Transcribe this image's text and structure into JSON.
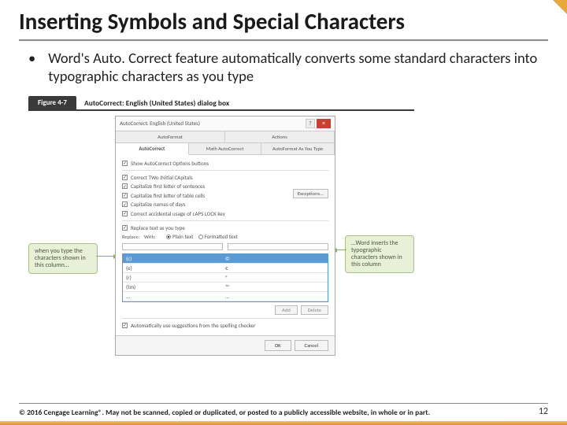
{
  "title": "Inserting Symbols and Special Characters",
  "bullet": "Word's Auto. Correct feature automatically converts some standard characters into typographic characters as you type",
  "figure": {
    "tab": "Figure 4-7",
    "caption": "AutoCorrect: English (United States) dialog box"
  },
  "dialog": {
    "title": "AutoCorrect: English (United States)",
    "tabs": [
      "AutoFormat",
      "Actions",
      "AutoCorrect",
      "Math AutoCorrect",
      "AutoFormat As You Type"
    ],
    "active_tab": 2,
    "opt_show": "Show AutoCorrect Options buttons",
    "checks": [
      "Correct TWo INitial CApitals",
      "Capitalize first letter of sentences",
      "Capitalize first letter of table cells",
      "Capitalize names of days",
      "Correct accidental usage of cAPS LOCK key"
    ],
    "exceptions": "Exceptions...",
    "replace_chk": "Replace text as you type",
    "replace_lbl": "Replace:",
    "with_lbl": "With:",
    "plain": "Plain text",
    "formatted": "Formatted text",
    "list": [
      {
        "a": "(c)",
        "b": "©"
      },
      {
        "a": "(e)",
        "b": "€"
      },
      {
        "a": "(r)",
        "b": "®"
      },
      {
        "a": "(tm)",
        "b": "™"
      },
      {
        "a": "...",
        "b": "…"
      }
    ],
    "add": "Add",
    "delete": "Delete",
    "auto_spell": "Automatically use suggestions from the spelling checker",
    "ok": "OK",
    "cancel": "Cancel"
  },
  "callouts": {
    "left": "when you type the characters shown in this column…",
    "right": "…Word inserts the typographic characters shown in this column"
  },
  "copyright": "© 2016 Cengage Learning®. May not be scanned, copied or duplicated, or posted to a publicly accessible website, in whole or in part.",
  "page": "12"
}
